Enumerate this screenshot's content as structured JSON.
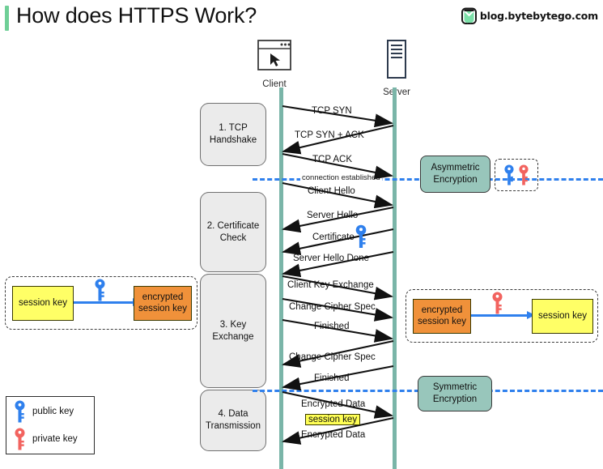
{
  "header": {
    "title": "How does HTTPS Work?",
    "brand_text": "blog.bytebytego.com",
    "brand_icon": "bytebytego-logo-icon",
    "accent_color": "#6fcf97"
  },
  "actors": {
    "client": {
      "label": "Client",
      "icon": "browser-window-icon"
    },
    "server": {
      "label": "Server",
      "icon": "server-rack-icon"
    }
  },
  "phases": [
    {
      "id": "phase-1",
      "label": "1. TCP\nHandshake",
      "line1": "1. TCP",
      "line2": "Handshake"
    },
    {
      "id": "phase-2",
      "label": "2. Certificate\nCheck",
      "line1": "2. Certificate",
      "line2": "Check"
    },
    {
      "id": "phase-3",
      "label": "3. Key\nExchange",
      "line1": "3. Key",
      "line2": "Exchange"
    },
    {
      "id": "phase-4",
      "label": "4. Data\nTransmission",
      "line1": "4. Data",
      "line2": "Transmission"
    }
  ],
  "dividers": {
    "connection_established": "connection established",
    "color": "#2f80ed"
  },
  "messages": [
    {
      "label": "TCP SYN",
      "direction": "client-to-server"
    },
    {
      "label": "TCP SYN + ACK",
      "direction": "server-to-client"
    },
    {
      "label": "TCP ACK",
      "direction": "client-to-server"
    },
    {
      "label": "Client Hello",
      "direction": "client-to-server"
    },
    {
      "label": "Server Hello",
      "direction": "server-to-client"
    },
    {
      "label": "Certificate",
      "direction": "server-to-client",
      "icon": "public-key-icon"
    },
    {
      "label": "Server Hello Done",
      "direction": "server-to-client"
    },
    {
      "label": "Client Key Exchange",
      "direction": "client-to-server"
    },
    {
      "label": "Change Cipher Spec",
      "direction": "client-to-server"
    },
    {
      "label": "Finished",
      "direction": "client-to-server"
    },
    {
      "label": "Change Cipher Spec",
      "direction": "server-to-client"
    },
    {
      "label": "Finished",
      "direction": "server-to-client"
    },
    {
      "label": "Encrypted  Data",
      "direction": "client-to-server"
    },
    {
      "label": "session key",
      "direction": "none",
      "highlight": true
    },
    {
      "label": "Encrypted Data",
      "direction": "server-to-client"
    }
  ],
  "panels": {
    "encrypt": {
      "name": "client-side-encryption-panel",
      "source_label": "session key",
      "result_line1": "encrypted",
      "result_line2": "session key",
      "key_icon": "public-key-icon",
      "arrow_color": "#2f80ed"
    },
    "decrypt": {
      "name": "server-side-decryption-panel",
      "source_line1": "encrypted",
      "source_line2": "session key",
      "result_label": "session key",
      "key_icon": "private-key-icon",
      "arrow_color": "#2f80ed"
    }
  },
  "tags": {
    "asymmetric": {
      "line1": "Asymmetric",
      "line2": "Encryption",
      "color": "#98c6bb"
    },
    "symmetric": {
      "line1": "Symmetric",
      "line2": "Encryption",
      "color": "#98c6bb"
    }
  },
  "legend": [
    {
      "icon": "public-key-icon",
      "label": "public key",
      "color": "#2f80ed"
    },
    {
      "icon": "private-key-icon",
      "label": "private key",
      "color": "#f2635f"
    }
  ],
  "colors": {
    "lifeline": "#7ab5a8",
    "phase_fill": "#ebebeb",
    "session_key_yellow": "#ffff66",
    "encrypted_orange": "#f0913a",
    "public_key_blue": "#2f80ed",
    "private_key_red": "#f2635f"
  }
}
